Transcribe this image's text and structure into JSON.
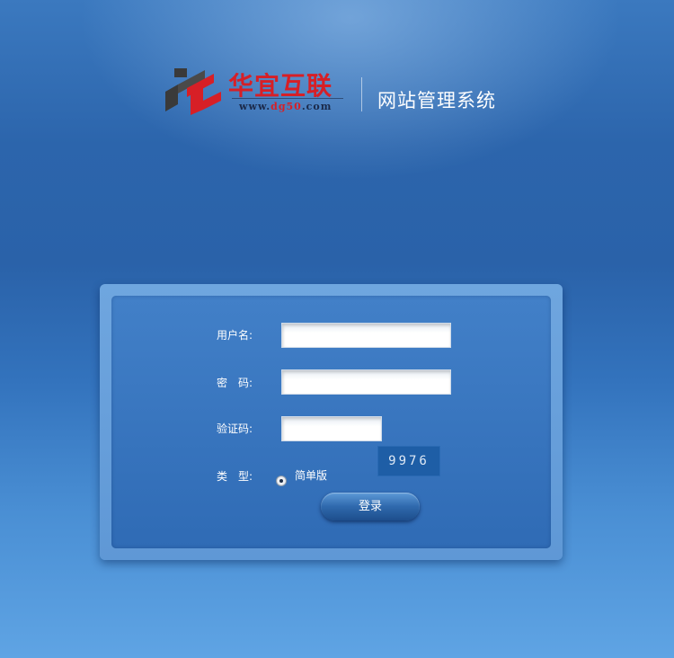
{
  "header": {
    "brand_name": "华宜互联",
    "brand_url_prefix": "www.",
    "brand_url_highlight": "dg50",
    "brand_url_suffix": ".com",
    "system_title": "网站管理系统"
  },
  "login_form": {
    "username_label": "用户名:",
    "username_value": "",
    "password_label": "密　码:",
    "password_value": "",
    "captcha_label": "验证码:",
    "captcha_value": "",
    "captcha_code": "9976",
    "type_label": "类　型:",
    "type_option": "简单版",
    "submit_label": "登录"
  },
  "colors": {
    "brand_red": "#d71f26",
    "logo_dark": "#3a3a3a",
    "background_blue": "#2c65ac",
    "panel_blue": "#3a79c2"
  }
}
